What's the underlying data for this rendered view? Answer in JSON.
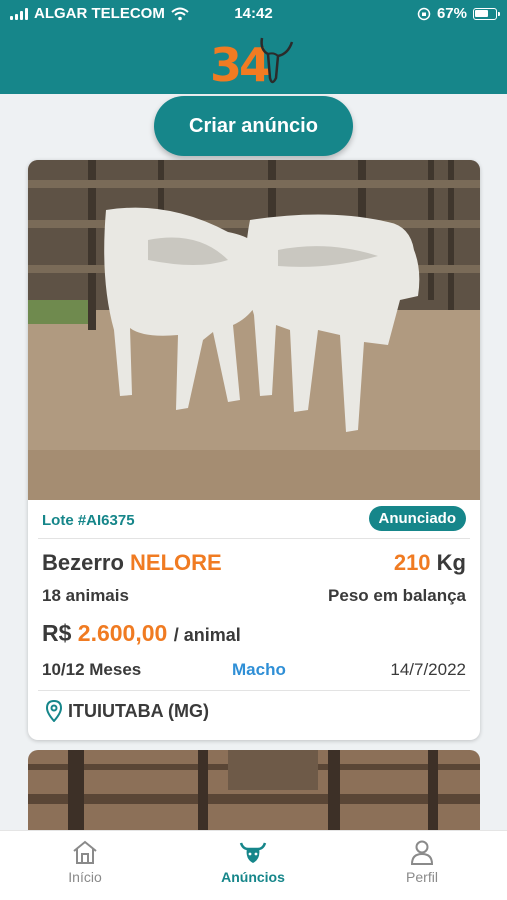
{
  "status_bar": {
    "carrier": "ALGAR TELECOM",
    "time": "14:42",
    "battery": "67%",
    "battery_level": 0.67
  },
  "header": {
    "logo_text": "34"
  },
  "create_button": {
    "label": "Criar anúncio"
  },
  "listing": {
    "lot": "Lote #AI6375",
    "status": "Anunciado",
    "category": "Bezerro",
    "breed": "NELORE",
    "weight_value": "210",
    "weight_unit": "Kg",
    "animal_count": "18 animais",
    "weighing_type": "Peso em balança",
    "price_currency": "R$",
    "price_value": "2.600,00",
    "price_unit": "/ animal",
    "age": "10/12 Meses",
    "sex": "Macho",
    "date": "14/7/2022",
    "location": "ITUIUTABA (MG)"
  },
  "tab_bar": {
    "items": [
      {
        "label": "Início",
        "icon": "home-icon"
      },
      {
        "label": "Anúncios",
        "icon": "cattle-icon"
      },
      {
        "label": "Perfil",
        "icon": "user-icon"
      }
    ]
  },
  "colors": {
    "primary": "#16868a",
    "accent": "#f07b22",
    "male": "#2f8fd6"
  }
}
